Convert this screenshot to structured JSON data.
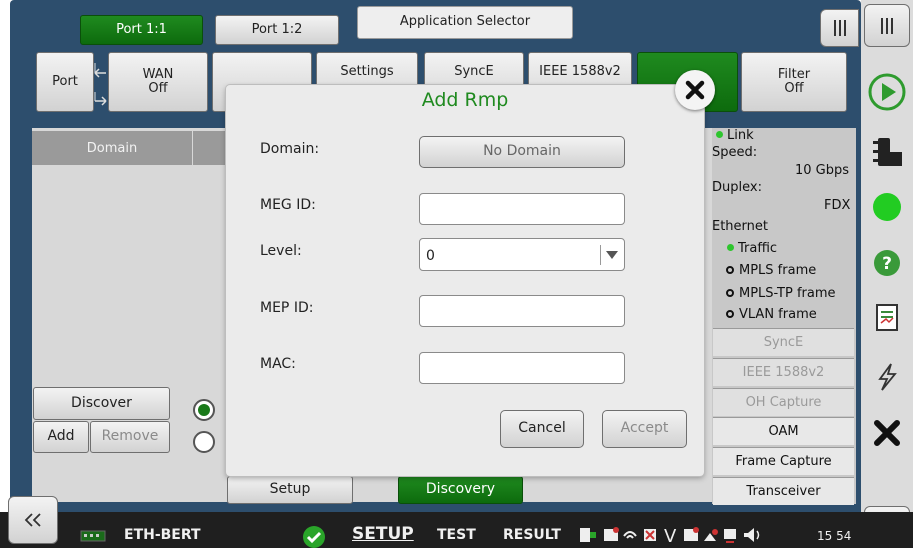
{
  "top_tabs": {
    "port_1_1": "Port 1:1",
    "port_1_2": "Port 1:2",
    "application_selector": "Application Selector"
  },
  "function_bar": {
    "port": "Port",
    "wan": "WAN",
    "wan_value": "Off",
    "settings": "Settings",
    "synce": "SyncE",
    "ieee": "IEEE 1588v2",
    "filter": "Filter",
    "filter_value": "Off"
  },
  "left_panel": {
    "domain_header": "Domain",
    "discover": "Discover",
    "add": "Add",
    "remove": "Remove",
    "setup_tab": "Setup",
    "discovery_tab": "Discovery"
  },
  "status_panel": {
    "link": "Link",
    "speed_label": "Speed:",
    "speed_value": "10 Gbps",
    "duplex_label": "Duplex:",
    "duplex_value": "FDX",
    "ethernet": "Ethernet",
    "traffic": "Traffic",
    "mpls": "MPLS frame",
    "mpls_tp": "MPLS-TP frame",
    "vlan": "VLAN frame",
    "buttons": [
      "SyncE",
      "IEEE 1588v2",
      "OH Capture",
      "OAM",
      "Frame Capture",
      "Transceiver"
    ]
  },
  "dialog": {
    "title": "Add Rmp",
    "domain_label": "Domain:",
    "domain_value": "No Domain",
    "meg_label": "MEG ID:",
    "meg_value": "",
    "level_label": "Level:",
    "level_value": "0",
    "mep_label": "MEP ID:",
    "mep_value": "",
    "mac_label": "MAC:",
    "mac_value": "",
    "cancel": "Cancel",
    "accept": "Accept"
  },
  "bottom_bar": {
    "app": "ETH-BERT",
    "setup": "SETUP",
    "test": "TEST",
    "result": "RESULT",
    "time": "15 54"
  },
  "colors": {
    "frame": "#2d4e6d",
    "active_green": "#1f8a1f",
    "dialog_title": "#1f8a1f"
  },
  "icons": [
    "chevron-left-double-icon",
    "chevron-right-double-icon",
    "play-icon",
    "traffic-light-icon",
    "status-led-icon",
    "help-icon",
    "report-icon",
    "lightning-icon",
    "close-icon",
    "check-circle-icon",
    "menu-icon"
  ]
}
